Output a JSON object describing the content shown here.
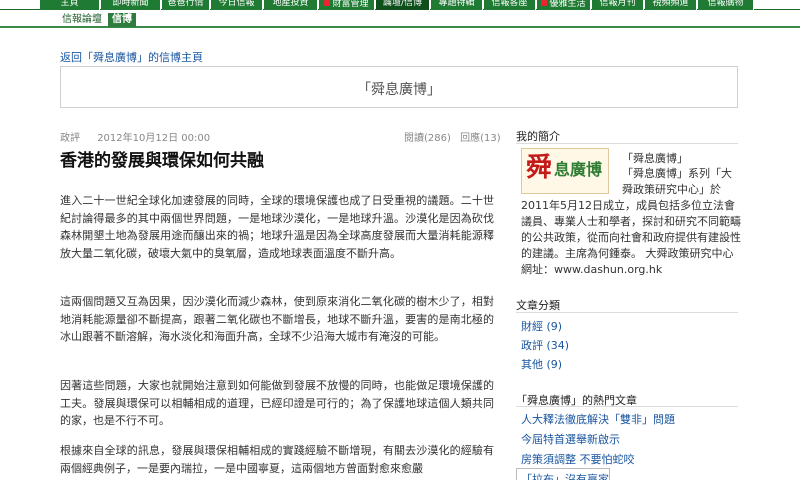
{
  "top_nav": [
    {
      "label": "主頁",
      "active": false,
      "dot": false
    },
    {
      "label": "即時新聞",
      "active": false,
      "dot": false
    },
    {
      "label": "爸爸行情",
      "active": false,
      "dot": false
    },
    {
      "label": "今日信報",
      "active": false,
      "dot": false
    },
    {
      "label": "地產投資",
      "active": false,
      "dot": false
    },
    {
      "label": "財富管理",
      "active": false,
      "dot": true
    },
    {
      "label": "論壇/信博",
      "active": true,
      "dot": false
    },
    {
      "label": "專題特輯",
      "active": false,
      "dot": false
    },
    {
      "label": "信報客座",
      "active": false,
      "dot": false
    },
    {
      "label": "優雅生活",
      "active": false,
      "dot": true
    },
    {
      "label": "信報月刊",
      "active": false,
      "dot": false
    },
    {
      "label": "視頻頻道",
      "active": false,
      "dot": false
    },
    {
      "label": "信報購物",
      "active": false,
      "dot": false
    }
  ],
  "sub_nav": [
    {
      "label": "信報論壇",
      "active": false
    },
    {
      "label": "信博",
      "active": true
    }
  ],
  "back_link": "返回「舜息廣博」的信博主頁",
  "banner_title": "「舜息廣博」",
  "article": {
    "author": "政評",
    "date": "2012年10月12日 00:00",
    "views": "閱讀(286)",
    "replies": "回應(13)",
    "title": "香港的發展與環保如何共融",
    "paragraphs": [
      "進入二十一世紀全球化加速發展的同時，全球的環境保護也成了日受重視的議題。二十世紀討論得最多的其中兩個世界問題，一是地球沙漠化，一是地球升溫。沙漠化是因為砍伐森林開墾土地為發展用途而釀出來的禍；地球升溫是因為全球高度發展而大量消耗能源釋放大量二氧化碳，破壞大氣中的臭氧層，造成地球表面溫度不斷升高。",
      "這兩個問題又互為因果，因沙漠化而減少森林，使到原來消化二氧化碳的樹木少了，相對地消耗能源量卻不斷提高，跟著二氧化碳也不斷增長，地球不斷升溫，要害的是南北極的冰山跟著不斷溶解，海水淡化和海面升高，全球不少沿海大城市有淹沒的可能。",
      "因著這些問題，大家也就開始注意到如何能做到發展不放慢的同時，也能做足環境保護的工夫。發展與環保可以相輔相成的道理，已經印證是可行的；為了保護地球這個人類共同的家，也是不行不可。",
      "根據來自全球的訊息，發展與環保相輔相成的實踐經驗不斷增現，有關去沙漠化的經驗有兩個經典例子，一是要內瑞拉，一是中國寧夏，這兩個地方曾面對愈來愈嚴"
    ]
  },
  "sidebar": {
    "profile_heading": "我的簡介",
    "logo_char": "舜",
    "logo_rest": "息廣博",
    "profile_name": "「舜息廣博」",
    "profile_text": "「舜息廣博」系列「大舜政策研究中心」於",
    "profile_text2": "2011年5月12日成立，成員包括多位立法會議員、專業人士和學者，探討和研究不同範疇的公共政策，從而向社會和政府提供有建設性的建議。主席為何鍾泰。 大舜政策研究中心網址：www.dashun.org.hk",
    "categories_heading": "文章分類",
    "categories": [
      "財經 (9)",
      "政評 (34)",
      "其他 (9)"
    ],
    "hot_heading": "「舜息廣博」的熱門文章",
    "hot_articles": [
      "人大釋法徹底解決「雙非」問題",
      "今屆特首選舉新啟示",
      "房策須調整 不要怕蛇咬",
      "「拉布」沒有贏家"
    ]
  }
}
